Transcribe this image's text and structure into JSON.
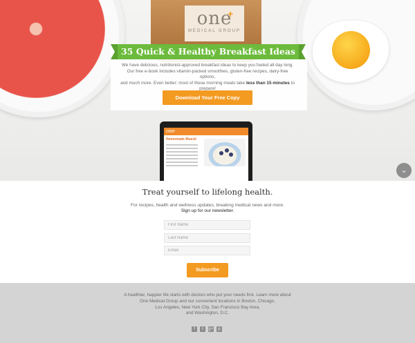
{
  "brand": {
    "logo_word": "one",
    "logo_sub": "MEDICAL GROUP",
    "accent": "#f39a21",
    "ribbon_color": "#6cbb3c"
  },
  "hero": {
    "title": "35 Quick & Healthy Breakfast Ideas",
    "intro_line1": "We have delicious, nutritionist-approved breakfast ideas to keep you fueled all day long.",
    "intro_line2": "Our free e-book includes vitamin-packed smoothies, gluten-free recipes, dairy-free options,",
    "intro_line3": "and much more. Even better: most of these morning meals take ",
    "intro_bold": "less than 15 minutes",
    "intro_after": " to",
    "intro_line4": "prepare!",
    "cta_label": "Download Your Free Copy"
  },
  "tablet": {
    "header": "one",
    "recipe_title": "Homemade Muesli"
  },
  "scroll_icon": "chevron-down-icon",
  "newsletter": {
    "title": "Treat yourself to lifelong health.",
    "subtitle": "For recipes, health and wellness updates, breaking medical news and more.",
    "subtitle2": "Sign up for our newsletter.",
    "first_name_placeholder": "First Name",
    "last_name_placeholder": "Last Name",
    "email_placeholder": "Email",
    "subscribe_label": "Subscribe"
  },
  "footer": {
    "line1": "A healthier, happier life starts with doctors who put your needs first. Learn more about",
    "line2": "One Medical Group and our convenient locations in Boston, Chicago,",
    "line3": "Los Angeles, New York City, San Francisco Bay Area,",
    "line4": "and Washington, D.C.",
    "social": [
      {
        "icon": "facebook-icon",
        "glyph": "f"
      },
      {
        "icon": "twitter-icon",
        "glyph": "t"
      },
      {
        "icon": "google-plus-icon",
        "glyph": "g+"
      },
      {
        "icon": "pinterest-icon",
        "glyph": "p"
      }
    ]
  }
}
